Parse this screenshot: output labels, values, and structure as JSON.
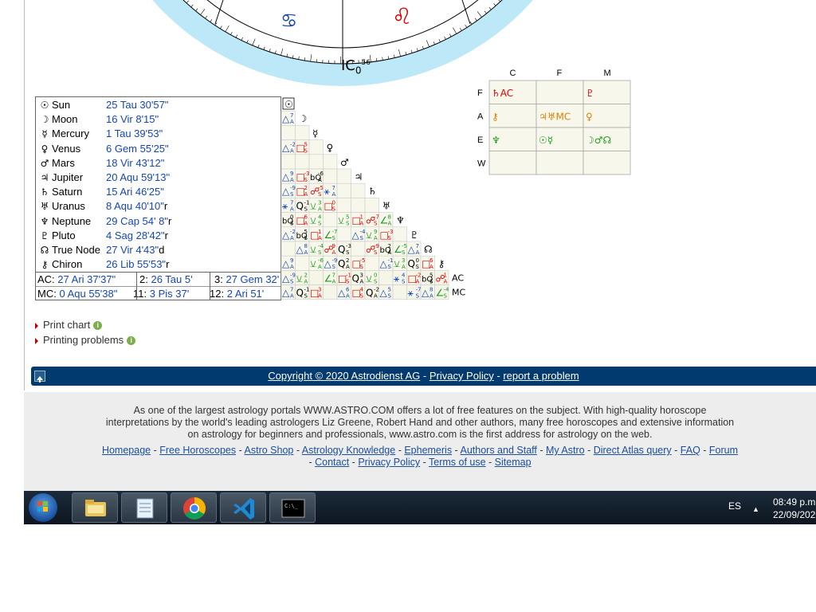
{
  "chart": {
    "ic_label": "IC",
    "ic_deg": "0",
    "ic_min": "56",
    "signs_visible": [
      "cancer-glyph",
      "leo-glyph"
    ]
  },
  "planets": [
    {
      "glyph": "☉",
      "name": "Sun",
      "position": "25 Tau 30'57\"",
      "retro": ""
    },
    {
      "glyph": "☽",
      "name": "Moon",
      "position": "16  Vir   8'15\"",
      "retro": ""
    },
    {
      "glyph": "☿",
      "name": "Mercury",
      "position": "1 Tau 39'53\"",
      "retro": ""
    },
    {
      "glyph": "♀",
      "name": "Venus",
      "position": "6 Gem 55'25\"",
      "retro": ""
    },
    {
      "glyph": "♂",
      "name": "Mars",
      "position": "18  Vir  43'12\"",
      "retro": ""
    },
    {
      "glyph": "♃",
      "name": "Jupiter",
      "position": "20 Aqu 59'13\"",
      "retro": ""
    },
    {
      "glyph": "♄",
      "name": "Saturn",
      "position": "15  Ari  46'25\"",
      "retro": ""
    },
    {
      "glyph": "♅",
      "name": "Uranus",
      "position": "8 Aqu 40'10\"",
      "retro": "r"
    },
    {
      "glyph": "♆",
      "name": "Neptune",
      "position": "29 Cap 54'  8\"",
      "retro": "r"
    },
    {
      "glyph": "♇",
      "name": "Pluto",
      "position": "4 Sag 28'42\"",
      "retro": "r"
    },
    {
      "glyph": "☊",
      "name": "True Node",
      "position": "27  Vir    4'43\"",
      "retro": "d"
    },
    {
      "glyph": "⚷",
      "name": "Chiron",
      "position": "26  Lib  55'53\"",
      "retro": "r"
    }
  ],
  "houses": {
    "ac_label": "AC:",
    "ac_value": "27  Ari  37'37\"",
    "h2_label": "2:",
    "h2_value": "26 Tau    5'",
    "h3_label": "3:",
    "h3_value": "27 Gem 32'",
    "mc_label": "MC:",
    "mc_value": "0 Aqu 55'38\"",
    "h11_label": "11:",
    "h11_value": "3  Pis  37'",
    "h12_label": "12:",
    "h12_value": "2  Ari  51'"
  },
  "aspect_headers": [
    "☉",
    "☽",
    "☿",
    "♀",
    "♂",
    "♃",
    "♄",
    "♅",
    "♆",
    "♇",
    "☊",
    "⚷"
  ],
  "row_end_labels": [
    "AC",
    "MC"
  ],
  "elements_table": {
    "col_headers": [
      "C",
      "F",
      "M"
    ],
    "row_headers": [
      "F",
      "A",
      "E",
      "W"
    ],
    "cells": [
      [
        {
          "t": "♄AC",
          "c": "#d00"
        },
        {
          "t": "",
          "c": "#000"
        },
        {
          "t": "♇",
          "c": "#d00"
        }
      ],
      [
        {
          "t": "⚷",
          "c": "#e08000"
        },
        {
          "t": "♃♅MC",
          "c": "#e08000"
        },
        {
          "t": "♀",
          "c": "#e08000"
        }
      ],
      [
        {
          "t": "♆",
          "c": "#1a9a1a"
        },
        {
          "t": "☉☿",
          "c": "#1a9a1a"
        },
        {
          "t": "☽♂☊",
          "c": "#1a9a1a"
        }
      ],
      [
        {
          "t": "",
          "c": "#000"
        },
        {
          "t": "",
          "c": "#000"
        },
        {
          "t": "",
          "c": "#000"
        }
      ]
    ]
  },
  "links": {
    "print_chart": "Print chart",
    "printing_problems": "Printing problems"
  },
  "bluebar": {
    "copyright": "Copyright © 2020 Astrodienst AG",
    "sep1": " - ",
    "privacy": "Privacy Policy",
    "sep2": " - ",
    "report": "report a problem"
  },
  "footer": {
    "text": "As one of the largest astrology portals WWW.ASTRO.COM offers a lot of free features on the subject. With high-quality horoscope interpretations by the world's leading astrologers Liz Greene, Robert Hand and other authors, many free horoscopes and extensive information on astrology for beginners and professionals, www.astro.com is the first address for astrology on the web.",
    "links": [
      "Homepage",
      "Free Horoscopes",
      "Astro Shop",
      "Astrology Knowledge",
      "Ephemeris",
      "Authors and Staff",
      "My Astro",
      "Direct Atlas query",
      "FAQ",
      "Forum",
      "Contact",
      "Privacy Policy",
      "Terms of use",
      "Sitemap"
    ]
  },
  "taskbar": {
    "apps": [
      "windows-start",
      "file-explorer",
      "notepad",
      "chrome",
      "vscode",
      "command-prompt"
    ],
    "lang": "ES",
    "time": "08:49 p.m.",
    "date": "22/09/2020"
  },
  "colors": {
    "blue": "#1646b5",
    "red": "#d00",
    "green": "#1a9a1a",
    "bar": "#013a6e"
  }
}
